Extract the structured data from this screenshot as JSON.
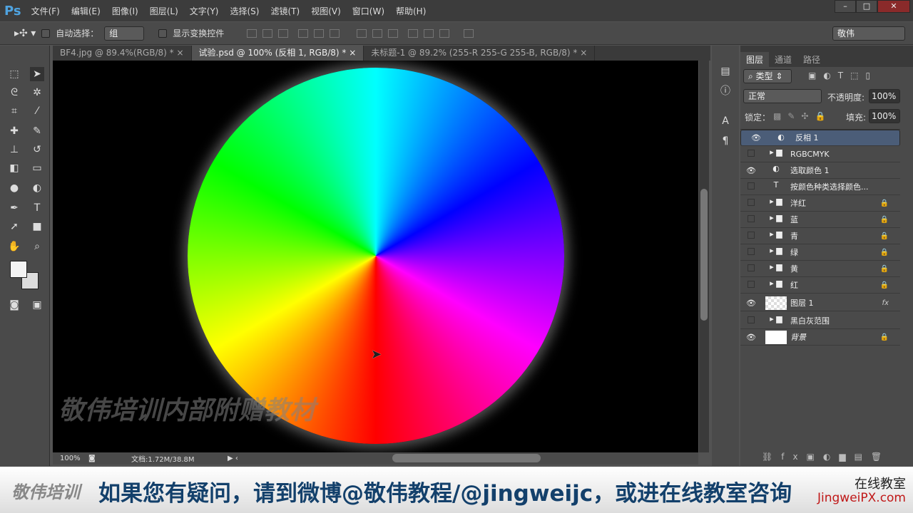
{
  "app": {
    "logo": "Ps",
    "menus": [
      "文件(F)",
      "编辑(E)",
      "图像(I)",
      "图层(L)",
      "文字(Y)",
      "选择(S)",
      "滤镜(T)",
      "视图(V)",
      "窗口(W)",
      "帮助(H)"
    ],
    "window_buttons": [
      "–",
      "□",
      "✕"
    ]
  },
  "options": {
    "auto_select_label": "自动选择：",
    "auto_select_value": "组",
    "show_transform_label": "显示变换控件",
    "workspace": "敬伟"
  },
  "tabs": [
    {
      "label": "BF4.jpg @ 89.4%(RGB/8) *",
      "close": "×"
    },
    {
      "label": "试验.psd @ 100% (反相 1, RGB/8) *",
      "close": "×"
    },
    {
      "label": "未标题-1 @ 89.2% (255-R 255-G 255-B, RGB/8) *",
      "close": "×"
    }
  ],
  "canvas": {
    "watermark": "敬伟培训内部附赠教材"
  },
  "status": {
    "zoom": "100%",
    "doc": "文档:1.72M/38.8M"
  },
  "layers_panel": {
    "tabs": [
      "图层",
      "通道",
      "路径"
    ],
    "filter": "类型",
    "blend_mode": "正常",
    "opacity_label": "不透明度:",
    "opacity": "100%",
    "lock_label": "锁定：",
    "fill_label": "填充:",
    "fill": "100%",
    "layers": [
      {
        "name": "反相 1",
        "visible": true,
        "kind": "adjust",
        "selected": true
      },
      {
        "name": "RGBCMYK",
        "visible": false,
        "kind": "group"
      },
      {
        "name": "选取颜色 1",
        "visible": true,
        "kind": "adjust"
      },
      {
        "name": "按颜色种类选择颜色...",
        "visible": false,
        "kind": "text"
      },
      {
        "name": "洋红",
        "visible": false,
        "kind": "group",
        "locked": true
      },
      {
        "name": "蓝",
        "visible": false,
        "kind": "group",
        "locked": true
      },
      {
        "name": "青",
        "visible": false,
        "kind": "group",
        "locked": true
      },
      {
        "name": "绿",
        "visible": false,
        "kind": "group",
        "locked": true
      },
      {
        "name": "黄",
        "visible": false,
        "kind": "group",
        "locked": true
      },
      {
        "name": "红",
        "visible": false,
        "kind": "group",
        "locked": true
      },
      {
        "name": "图层 1",
        "visible": true,
        "kind": "pixel",
        "fx": "fx"
      },
      {
        "name": "黑白灰范围",
        "visible": false,
        "kind": "group"
      },
      {
        "name": "背景",
        "visible": true,
        "kind": "background",
        "locked": true
      }
    ]
  },
  "banner": {
    "logo": "敬伟培训",
    "message": "如果您有疑问，请到微博@敬伟教程/@jingweijc，或进在线教室咨询",
    "right_title": "在线教室",
    "right_url": "JingweiPX.com"
  }
}
